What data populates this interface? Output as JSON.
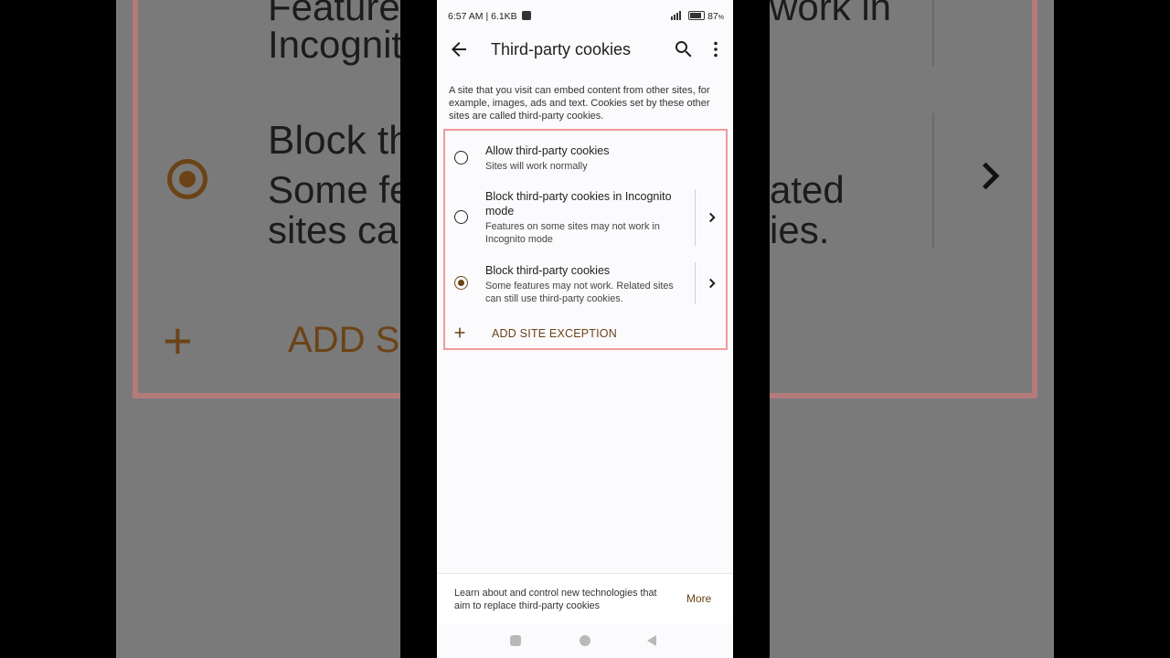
{
  "background": {
    "text_line1": "Features",
    "text_line1_right": "work in",
    "text_line2": "Incognito",
    "block_title": "Block th",
    "block_sub1": "Some fea",
    "block_sub1_right": "ated",
    "block_sub2": "sites can",
    "block_sub2_right": "ies.",
    "add_label": "ADD SI"
  },
  "status_bar": {
    "time_speed": "6:57 AM | 6.1KB",
    "battery": "87"
  },
  "app_bar": {
    "title": "Third-party cookies"
  },
  "description": "A site that you visit can embed content from other sites, for example, images, ads and text. Cookies set by these other sites are called third-party cookies.",
  "options": [
    {
      "title": "Allow third-party cookies",
      "subtitle": "Sites will work normally",
      "selected": false
    },
    {
      "title": "Block third-party cookies in Incognito mode",
      "subtitle": "Features on some sites may not work in Incognito mode",
      "selected": false
    },
    {
      "title": "Block third-party cookies",
      "subtitle": "Some features may not work. Related sites can still use third-party cookies.",
      "selected": true
    }
  ],
  "add_exception": "ADD SITE EXCEPTION",
  "bottom_card": {
    "text": "Learn about and control new technologies that aim to replace third-party cookies",
    "link": "More"
  },
  "colors": {
    "accent": "#6b4316",
    "highlight_border": "#ef9a9a"
  }
}
